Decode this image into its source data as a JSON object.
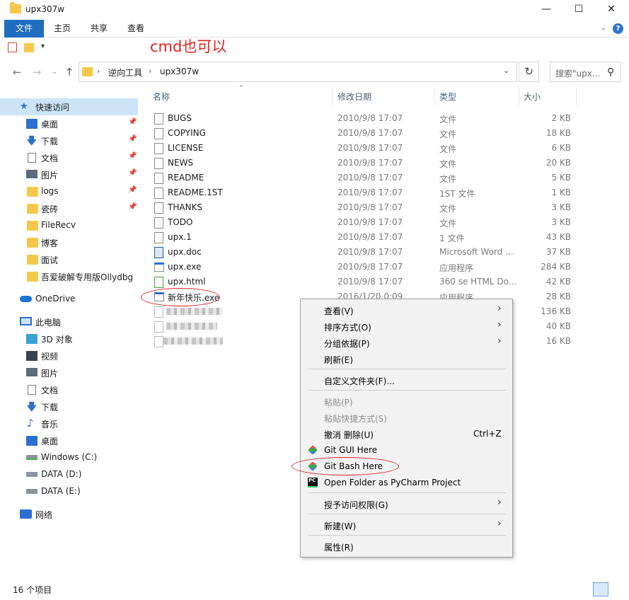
{
  "window": {
    "title": "upx307w",
    "controls": {
      "minimize": "—",
      "maximize": "☐",
      "close": "✕"
    }
  },
  "ribbon": {
    "tabs": [
      {
        "label": "文件",
        "active": true
      },
      {
        "label": "主页"
      },
      {
        "label": "共享"
      },
      {
        "label": "查看"
      }
    ],
    "help": "?"
  },
  "annotation": {
    "cmd_note": "cmd也可以"
  },
  "address": {
    "path": [
      "逆向工具",
      "upx307w"
    ],
    "search_placeholder": "搜索\"upx..."
  },
  "sidebar": {
    "items": [
      {
        "label": "快速访问",
        "icon": "star-icon",
        "selected": true
      },
      {
        "label": "桌面",
        "icon": "desktop-icon",
        "pinned": true
      },
      {
        "label": "下载",
        "icon": "download-icon",
        "pinned": true
      },
      {
        "label": "文档",
        "icon": "document-icon",
        "pinned": true
      },
      {
        "label": "图片",
        "icon": "picture-icon",
        "pinned": true
      },
      {
        "label": "logs",
        "icon": "folder-icon",
        "pinned": true
      },
      {
        "label": "瓷砖",
        "icon": "folder-icon",
        "pinned": true
      },
      {
        "label": "FileRecv",
        "icon": "folder-icon"
      },
      {
        "label": "博客",
        "icon": "folder-icon"
      },
      {
        "label": "面试",
        "icon": "folder-icon"
      },
      {
        "label": "吾爱破解专用版Ollydbg",
        "icon": "folder-icon"
      },
      {
        "label": "OneDrive",
        "icon": "cloud-icon"
      },
      {
        "label": "此电脑",
        "icon": "computer-icon"
      },
      {
        "label": "3D 对象",
        "icon": "3d-objects-icon"
      },
      {
        "label": "视频",
        "icon": "video-icon"
      },
      {
        "label": "图片",
        "icon": "picture-icon"
      },
      {
        "label": "文档",
        "icon": "document-icon"
      },
      {
        "label": "下载",
        "icon": "download-icon"
      },
      {
        "label": "音乐",
        "icon": "music-icon"
      },
      {
        "label": "桌面",
        "icon": "desktop-icon"
      },
      {
        "label": "Windows (C:)",
        "icon": "drive-icon"
      },
      {
        "label": "DATA (D:)",
        "icon": "drive-icon"
      },
      {
        "label": "DATA (E:)",
        "icon": "drive-icon"
      },
      {
        "label": "网络",
        "icon": "network-icon"
      }
    ]
  },
  "columns": {
    "name": "名称",
    "date": "修改日期",
    "type": "类型",
    "size": "大小"
  },
  "files": [
    {
      "name": "BUGS",
      "date": "2010/9/8 17:07",
      "type": "文件",
      "size": "2 KB"
    },
    {
      "name": "COPYING",
      "date": "2010/9/8 17:07",
      "type": "文件",
      "size": "18 KB"
    },
    {
      "name": "LICENSE",
      "date": "2010/9/8 17:07",
      "type": "文件",
      "size": "6 KB"
    },
    {
      "name": "NEWS",
      "date": "2010/9/8 17:07",
      "type": "文件",
      "size": "20 KB"
    },
    {
      "name": "README",
      "date": "2010/9/8 17:07",
      "type": "文件",
      "size": "5 KB"
    },
    {
      "name": "README.1ST",
      "date": "2010/9/8 17:07",
      "type": "1ST 文件",
      "size": "1 KB"
    },
    {
      "name": "THANKS",
      "date": "2010/9/8 17:07",
      "type": "文件",
      "size": "3 KB"
    },
    {
      "name": "TODO",
      "date": "2010/9/8 17:07",
      "type": "文件",
      "size": "3 KB"
    },
    {
      "name": "upx.1",
      "date": "2010/9/8 17:07",
      "type": "1 文件",
      "size": "43 KB"
    },
    {
      "name": "upx.doc",
      "date": "2010/9/8 17:07",
      "type": "Microsoft Word ...",
      "size": "37 KB"
    },
    {
      "name": "upx.exe",
      "date": "2010/9/8 17:07",
      "type": "应用程序",
      "size": "284 KB"
    },
    {
      "name": "upx.html",
      "date": "2010/9/8 17:07",
      "type": "360 se HTML Do...",
      "size": "42 KB"
    },
    {
      "name": "新年快乐.exe",
      "date": "2016/1/20 0:09",
      "type": "应用程序",
      "size": "28 KB"
    },
    {
      "name": "",
      "date": "",
      "type": "",
      "size": "136 KB"
    },
    {
      "name": "",
      "date": "",
      "type": "",
      "size": "40 KB"
    },
    {
      "name": "",
      "date": "",
      "type": "",
      "size": "16 KB"
    }
  ],
  "context_menu": {
    "items": [
      {
        "label": "查看(V)",
        "submenu": true
      },
      {
        "label": "排序方式(O)",
        "submenu": true
      },
      {
        "label": "分组依据(P)",
        "submenu": true
      },
      {
        "label": "刷新(E)"
      },
      {
        "label": "自定义文件夹(F)..."
      },
      {
        "label": "粘贴(P)",
        "disabled": true
      },
      {
        "label": "粘贴快捷方式(S)",
        "disabled": true
      },
      {
        "label": "撤消 删除(U)",
        "shortcut": "Ctrl+Z"
      },
      {
        "label": "Git GUI Here",
        "icon": "git-gui-icon"
      },
      {
        "label": "Git Bash Here",
        "icon": "git-bash-icon"
      },
      {
        "label": "Open Folder as PyCharm Project",
        "icon": "pycharm-icon"
      },
      {
        "label": "授予访问权限(G)",
        "submenu": true
      },
      {
        "label": "新建(W)",
        "submenu": true
      },
      {
        "label": "属性(R)"
      }
    ]
  },
  "status": {
    "item_count": "16 个项目"
  },
  "colors": {
    "accent": "#1f6cc1",
    "annotation": "#e02424",
    "selection": "#cce4f7"
  }
}
